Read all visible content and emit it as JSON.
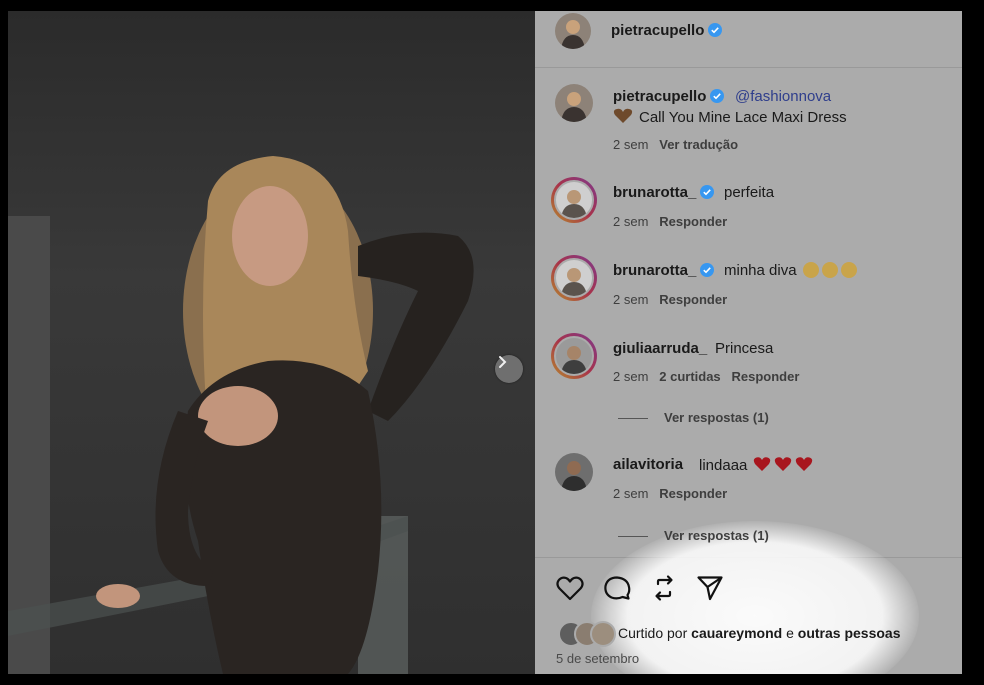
{
  "post": {
    "author": "pietracupello",
    "header_username": "pietracupello"
  },
  "caption": {
    "username": "pietracupello",
    "mention": "@fashionnova",
    "text": "Call You Mine Lace Maxi Dress",
    "time": "2 sem",
    "translate_label": "Ver tradução"
  },
  "comments": [
    {
      "username": "brunarotta_",
      "text": "perfeita",
      "time": "2 sem",
      "reply_label": "Responder",
      "verified": true
    },
    {
      "username": "brunarotta_",
      "text": "minha diva",
      "time": "2 sem",
      "reply_label": "Responder",
      "verified": true
    },
    {
      "username": "giuliaarruda_",
      "text": "Princesa",
      "time": "2 sem",
      "likes_label": "2 curtidas",
      "reply_label": "Responder",
      "view_replies": "Ver respostas (1)"
    },
    {
      "username": "ailavitoria",
      "text": "lindaaa",
      "time": "2 sem",
      "reply_label": "Responder",
      "view_replies": "Ver respostas (1)"
    }
  ],
  "likes": {
    "prefix": "Curtido por",
    "user": "cauareymond",
    "connector": "e",
    "others": "outras pessoas"
  },
  "date": "5 de setembro",
  "icons": [
    "heart-icon",
    "comment-icon",
    "repost-icon",
    "share-icon",
    "chevron-right-icon",
    "verified-icon"
  ],
  "colors": {
    "verified": "#3797f0",
    "panel_bg": "#ababab",
    "story_ring": "#a8324a"
  }
}
